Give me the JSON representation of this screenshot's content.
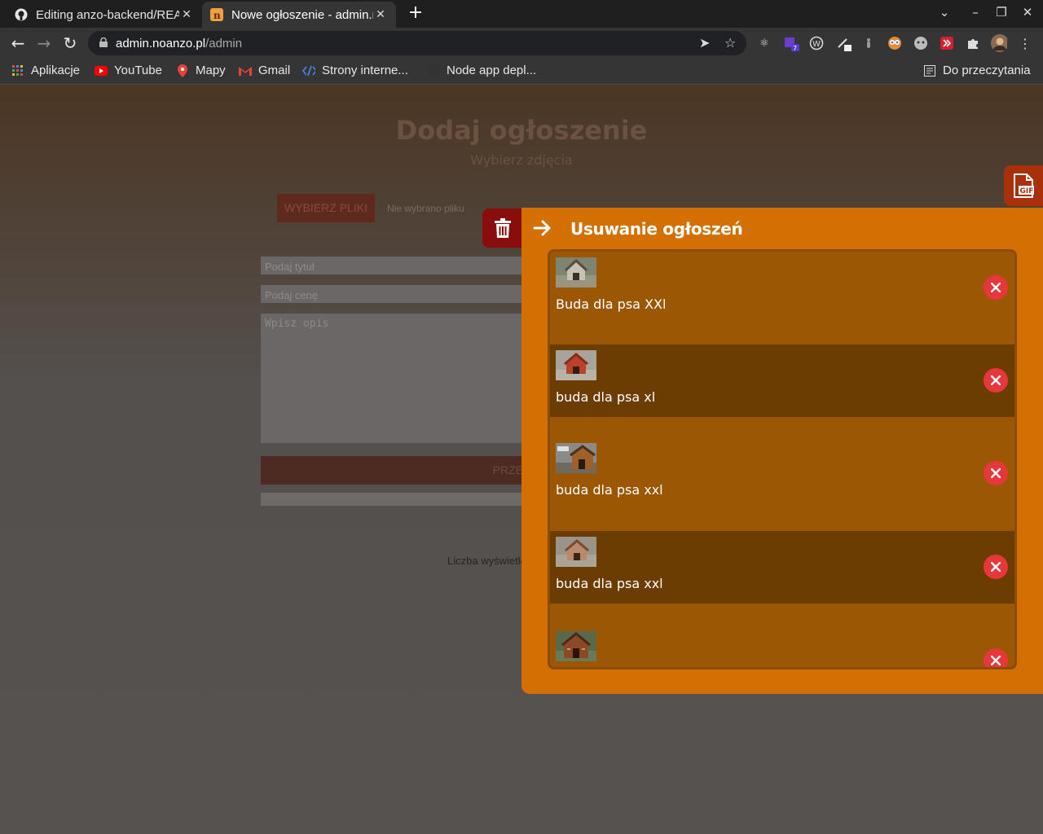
{
  "tabs": [
    {
      "title": "Editing anzo-backend/README",
      "active": false,
      "icon": "github-icon"
    },
    {
      "title": "Nowe ogłoszenie - admin.noanzo.pl",
      "active": true,
      "icon": "noanzo-favicon-icon"
    }
  ],
  "address": {
    "host": "admin.noanzo.pl",
    "path": "/admin"
  },
  "bookmarks": [
    {
      "label": "Aplikacje",
      "icon": "apps-grid-icon"
    },
    {
      "label": "YouTube",
      "icon": "youtube-icon"
    },
    {
      "label": "Mapy",
      "icon": "maps-pin-icon"
    },
    {
      "label": "Gmail",
      "icon": "gmail-icon"
    },
    {
      "label": "Strony interne...",
      "icon": "code-icon"
    },
    {
      "label": "Node app depl...",
      "icon": "github-icon"
    }
  ],
  "reading_list": "Do przeczytania",
  "form": {
    "title": "Dodaj ogłoszenie",
    "subtitle": "Wybierz zdjęcia",
    "choose_files": "WYBIERZ PLIKI",
    "no_file": "Nie wybrano pliku",
    "title_placeholder": "Podaj tytuł",
    "price_placeholder": "Podaj cenę",
    "desc_placeholder": "Wpisz opis",
    "submit": "PRZE",
    "views": "Liczba wyświetleń"
  },
  "panel": {
    "title": "Usuwanie ogłoszeń",
    "items": [
      {
        "label": "Buda dla psa XXl",
        "thumb": "doghouse-1"
      },
      {
        "label": "buda dla psa xl",
        "thumb": "doghouse-2"
      },
      {
        "label": "buda dla psa xxl",
        "thumb": "doghouse-3"
      },
      {
        "label": "buda dla psa xxl",
        "thumb": "doghouse-4"
      },
      {
        "label": "",
        "thumb": "doghouse-5"
      }
    ]
  },
  "colors": {
    "panel": "#d37004",
    "row_light": "#9b5704",
    "row_dark": "#6b3d03",
    "delete": "#e8373b",
    "trash_button": "#8a0d0d",
    "gif_button": "#a8310c"
  }
}
